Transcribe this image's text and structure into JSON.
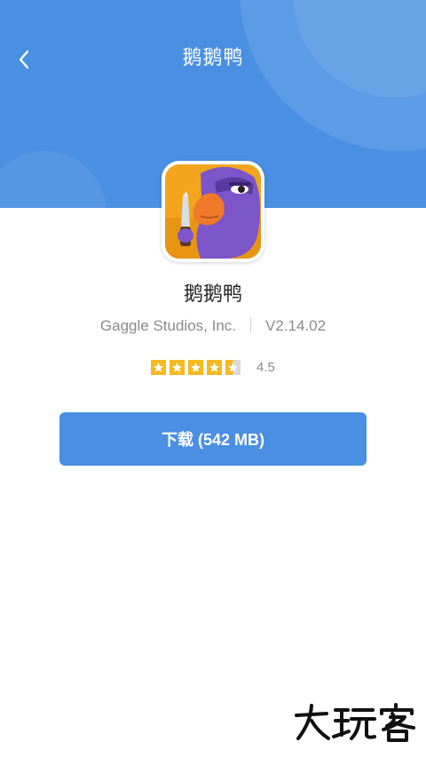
{
  "header": {
    "title": "鹅鹅鸭",
    "background": "#4a90e2"
  },
  "app": {
    "name": "鹅鹅鸭",
    "developer": "Gaggle Studios, Inc.",
    "version": "V2.14.02",
    "rating": 4.5,
    "rating_label": "4.5",
    "stars_total": 5
  },
  "download": {
    "label": "下载 (542 MB)",
    "color": "#4a8fe3"
  },
  "watermark": {
    "text": "大玩客"
  },
  "icons": {
    "back": "back-arrow-icon",
    "app": "goose-duck-app-icon",
    "star": "star-icon"
  }
}
